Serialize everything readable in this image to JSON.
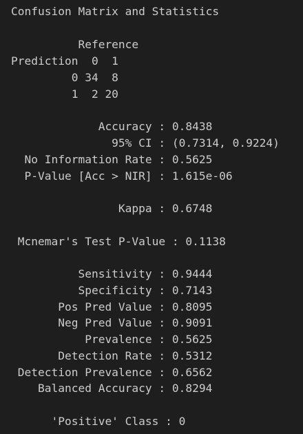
{
  "console": {
    "title": "Confusion Matrix and Statistics",
    "matrix": {
      "header": "          Reference",
      "columns": "Prediction  0  1",
      "row0": "         0 34  8",
      "row1": "         1  2 20"
    },
    "overall": {
      "accuracy": "             Accuracy : 0.8438",
      "ci": "               95% CI : (0.7314, 0.9224)",
      "nir": "  No Information Rate : 0.5625",
      "pvalue": "  P-Value [Acc > NIR] : 1.615e-06",
      "kappa": "                Kappa : 0.6748",
      "mcnemar": " Mcnemar's Test P-Value : 0.1138"
    },
    "class_stats": {
      "sensitivity": "          Sensitivity : 0.9444",
      "specificity": "          Specificity : 0.7143",
      "pos_pred": "       Pos Pred Value : 0.8095",
      "neg_pred": "       Neg Pred Value : 0.9091",
      "prevalence": "           Prevalence : 0.5625",
      "detection_rate": "       Detection Rate : 0.5312",
      "detection_prevalence": " Detection Prevalence : 0.6562",
      "balanced_accuracy": "    Balanced Accuracy : 0.8294",
      "positive_class": "      'Positive' Class : 0"
    }
  }
}
